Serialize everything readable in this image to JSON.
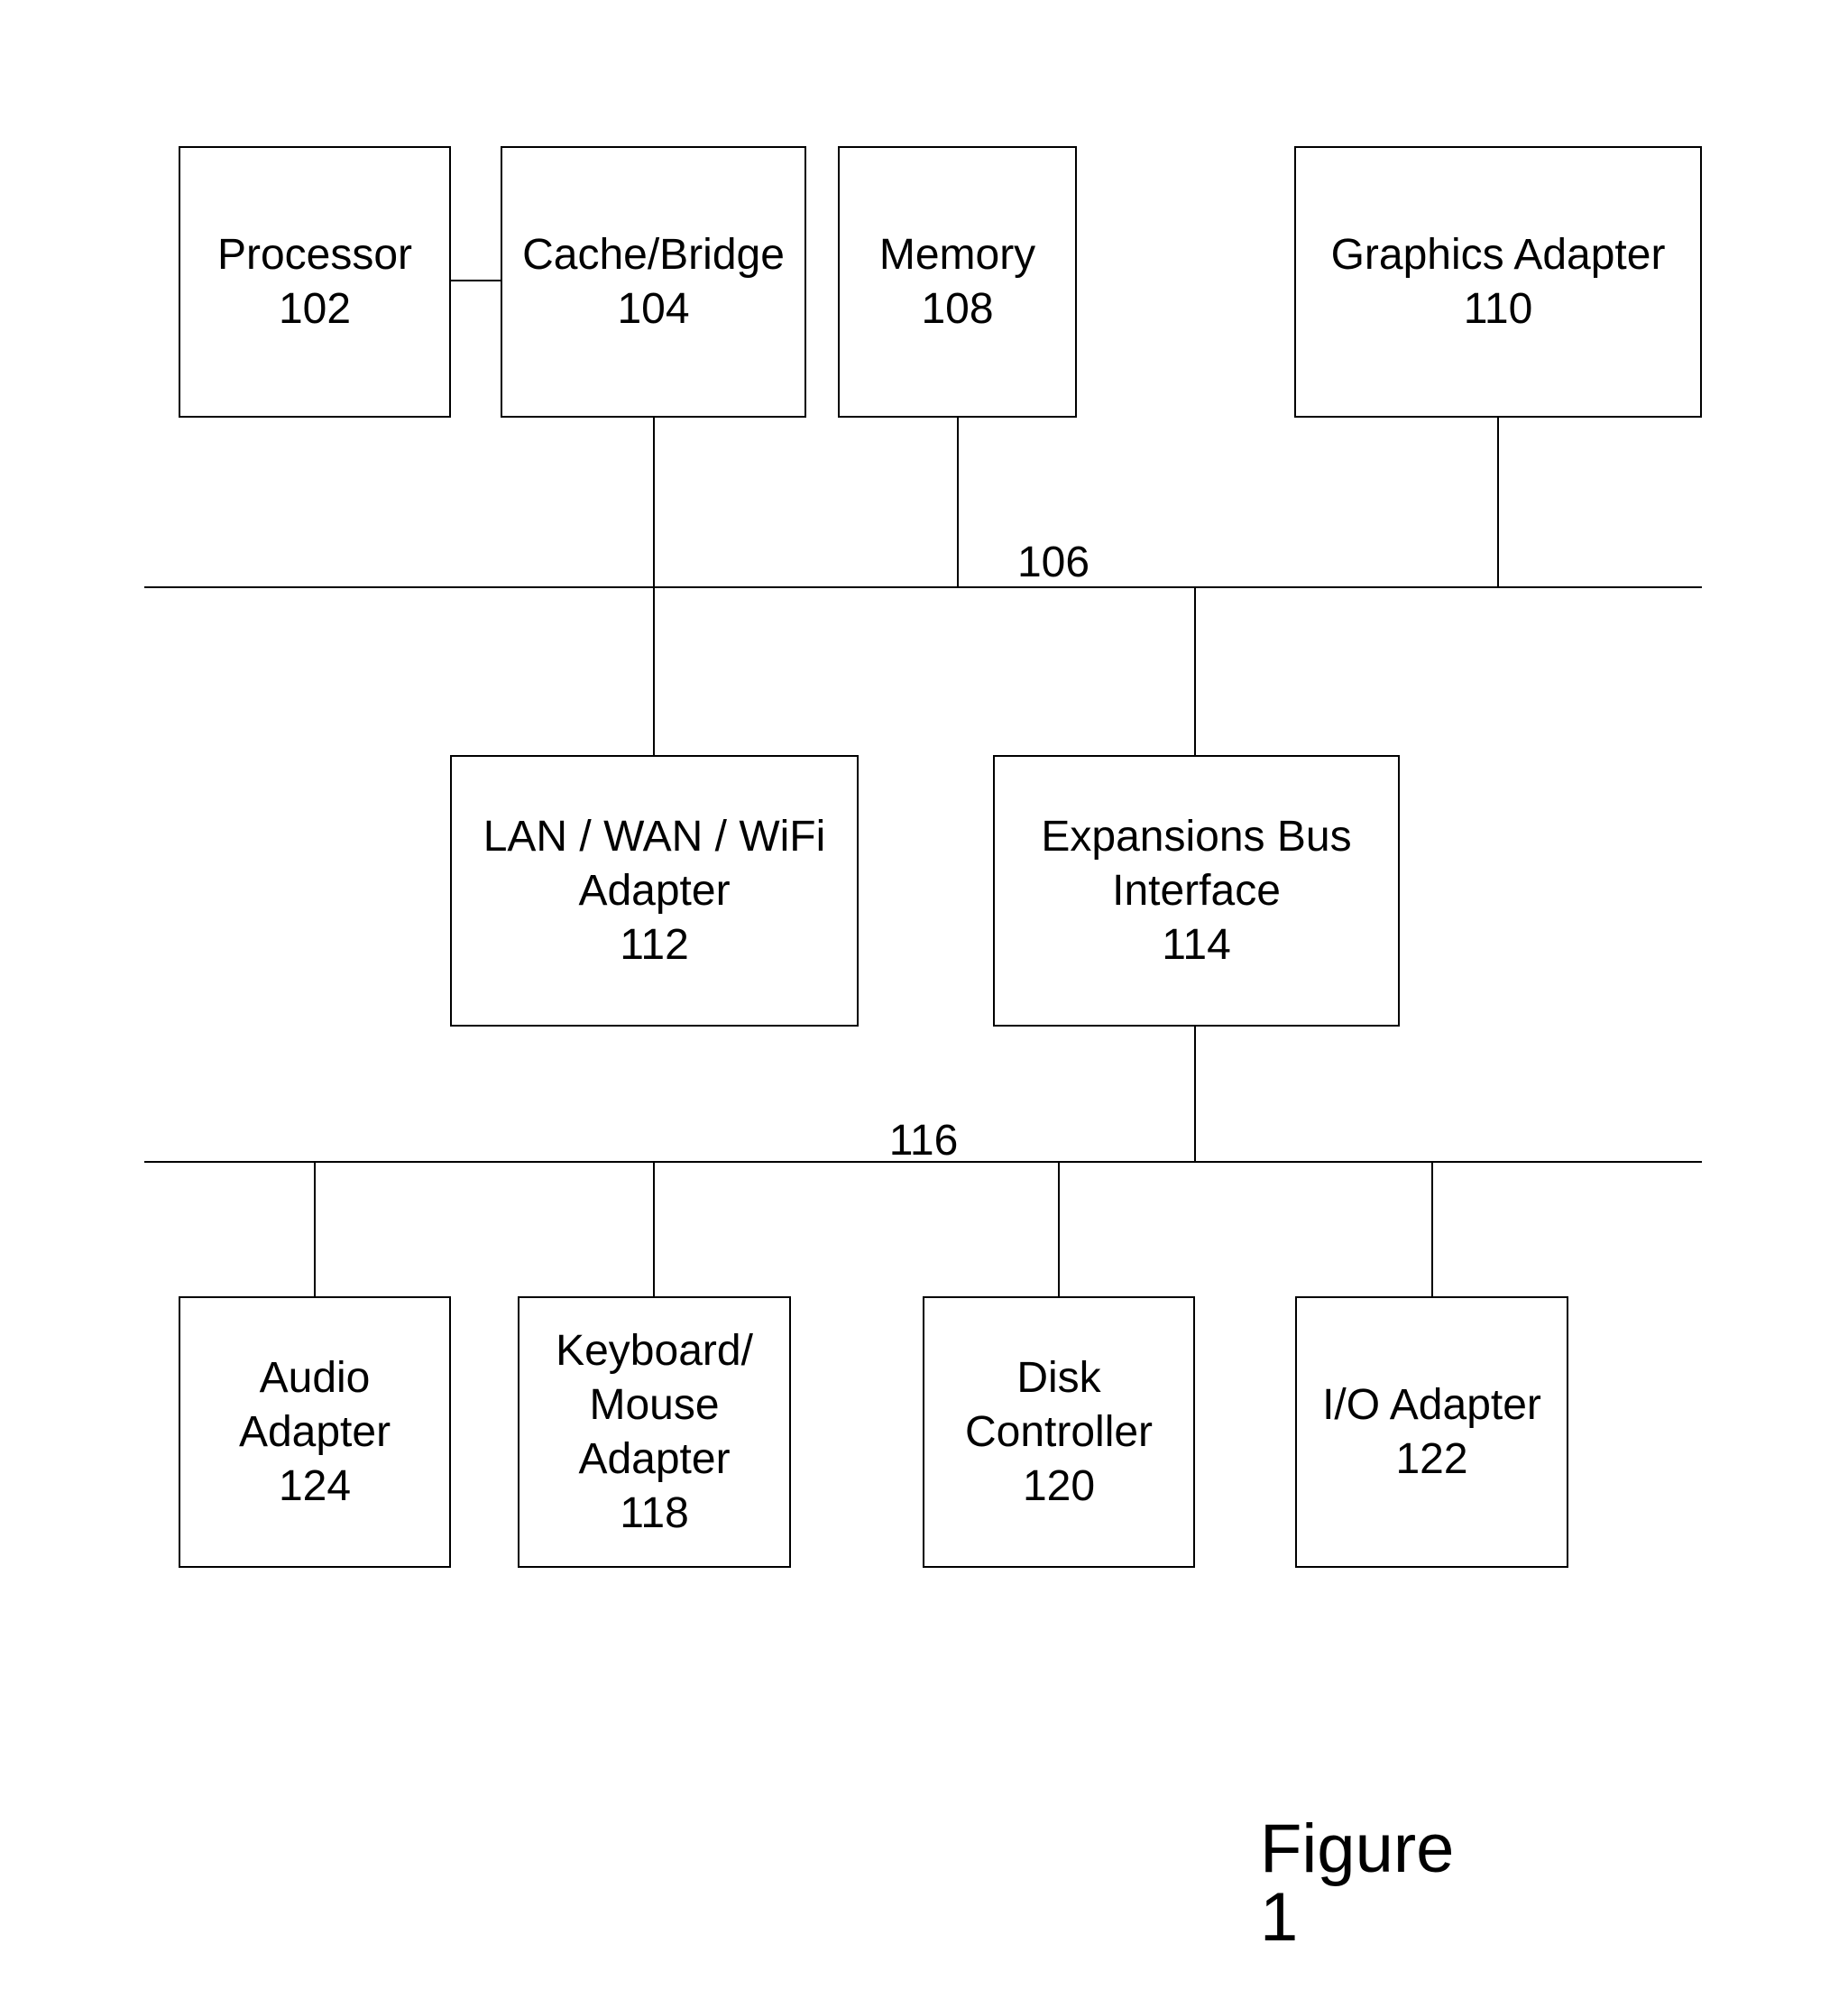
{
  "figure_label": "Figure 1",
  "buses": {
    "system_bus": {
      "label": "106"
    },
    "expansion_bus": {
      "label": "116"
    }
  },
  "components": {
    "processor": {
      "lines": [
        "Processor",
        "102"
      ]
    },
    "cache_bridge": {
      "lines": [
        "Cache/Bridge",
        "104"
      ]
    },
    "memory": {
      "lines": [
        "Memory",
        "108"
      ]
    },
    "graphics_adapter": {
      "lines": [
        "Graphics Adapter",
        "110"
      ]
    },
    "lan_wan_wifi_adapter": {
      "lines": [
        "LAN / WAN / WiFi",
        "Adapter",
        "112"
      ]
    },
    "expansion_bus_interface": {
      "lines": [
        "Expansions Bus",
        "Interface",
        "114"
      ]
    },
    "audio_adapter": {
      "lines": [
        "Audio",
        "Adapter",
        "124"
      ]
    },
    "keyboard_mouse_adapter": {
      "lines": [
        "Keyboard/",
        "Mouse",
        "Adapter",
        "118"
      ]
    },
    "disk_controller": {
      "lines": [
        "Disk",
        "Controller",
        "120"
      ]
    },
    "io_adapter": {
      "lines": [
        "I/O Adapter",
        "122"
      ]
    }
  }
}
